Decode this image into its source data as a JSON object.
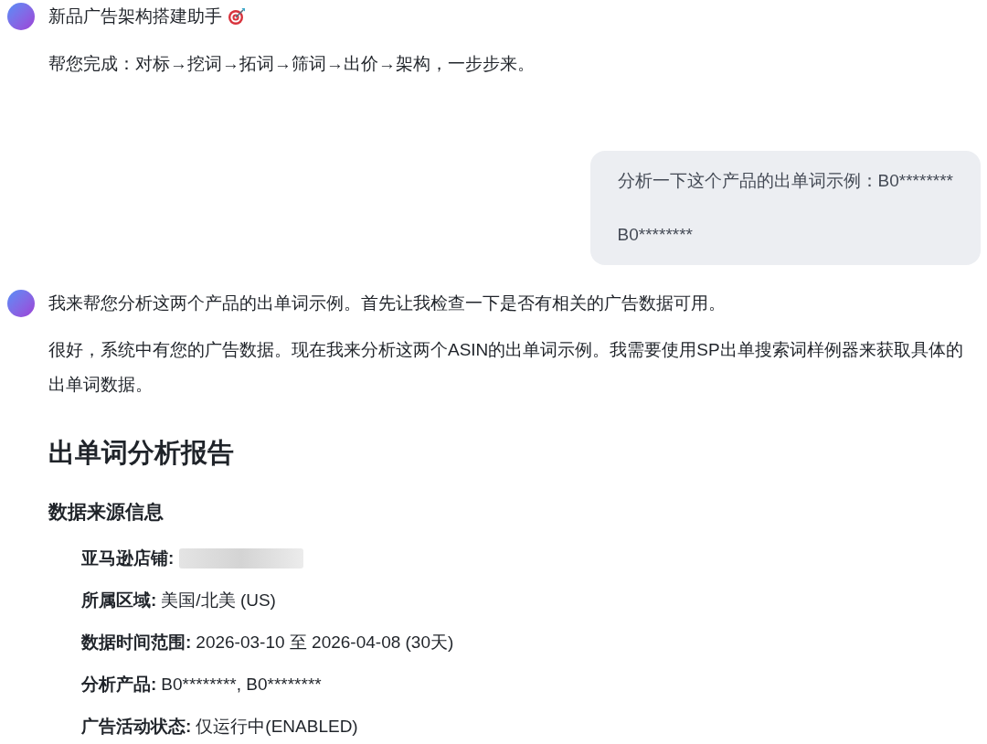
{
  "assistant_intro": {
    "title": "新品广告架构搭建助手",
    "subtitle": "帮您完成：对标→挖词→拓词→筛词→出价→架构，一步步来。"
  },
  "user_message": {
    "lines": [
      "分析一下这个产品的出单词示例：B0********",
      "B0********"
    ]
  },
  "assistant_reply": {
    "paragraphs": [
      "我来帮您分析这两个产品的出单词示例。首先让我检查一下是否有相关的广告数据可用。",
      "很好，系统中有您的广告数据。现在我来分析这两个ASIN的出单词示例。我需要使用SP出单搜索词样例器来获取具体的出单词数据。"
    ],
    "report": {
      "heading": "出单词分析报告",
      "section_title": "数据来源信息",
      "items": [
        {
          "kind": "redacted",
          "label": "亚马逊店铺:"
        },
        {
          "kind": "text",
          "label": "所属区域:",
          "value": "美国/北美 (US)"
        },
        {
          "kind": "text",
          "label": "数据时间范围:",
          "value": "2026-03-10 至 2026-04-08 (30天)"
        },
        {
          "kind": "text",
          "label": "分析产品:",
          "value": "B0********, B0********"
        },
        {
          "kind": "text",
          "label": "广告活动状态:",
          "value": "仅运行中(ENABLED)"
        }
      ]
    }
  }
}
